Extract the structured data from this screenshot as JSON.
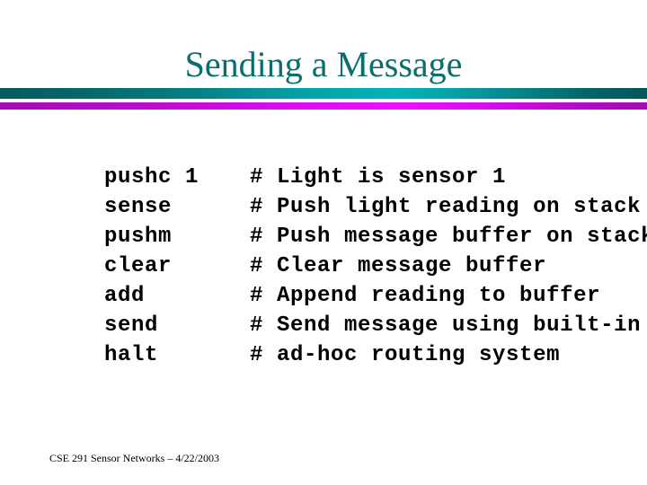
{
  "slide": {
    "title": "Sending a Message",
    "footer": "CSE 291 Sensor Networks – 4/22/2003",
    "colors": {
      "title": "#0a6e6e",
      "bar_teal_dark": "#055a5d",
      "bar_teal_bright": "#01b4b9",
      "bar_magenta_dark": "#a30cb4",
      "bar_magenta_bright": "#ef0fff",
      "background": "#ffffff",
      "code_text": "#000000"
    }
  },
  "code": {
    "lines": [
      {
        "op": "pushc 1",
        "comment": "# Light is sensor 1"
      },
      {
        "op": "sense",
        "comment": "# Push light reading on stack"
      },
      {
        "op": "pushm",
        "comment": "# Push message buffer on stack"
      },
      {
        "op": "clear",
        "comment": "# Clear message buffer"
      },
      {
        "op": "add",
        "comment": "# Append reading to buffer"
      },
      {
        "op": "send",
        "comment": "# Send message using built-in"
      },
      {
        "op": "halt",
        "comment": "# ad-hoc routing system"
      }
    ]
  }
}
